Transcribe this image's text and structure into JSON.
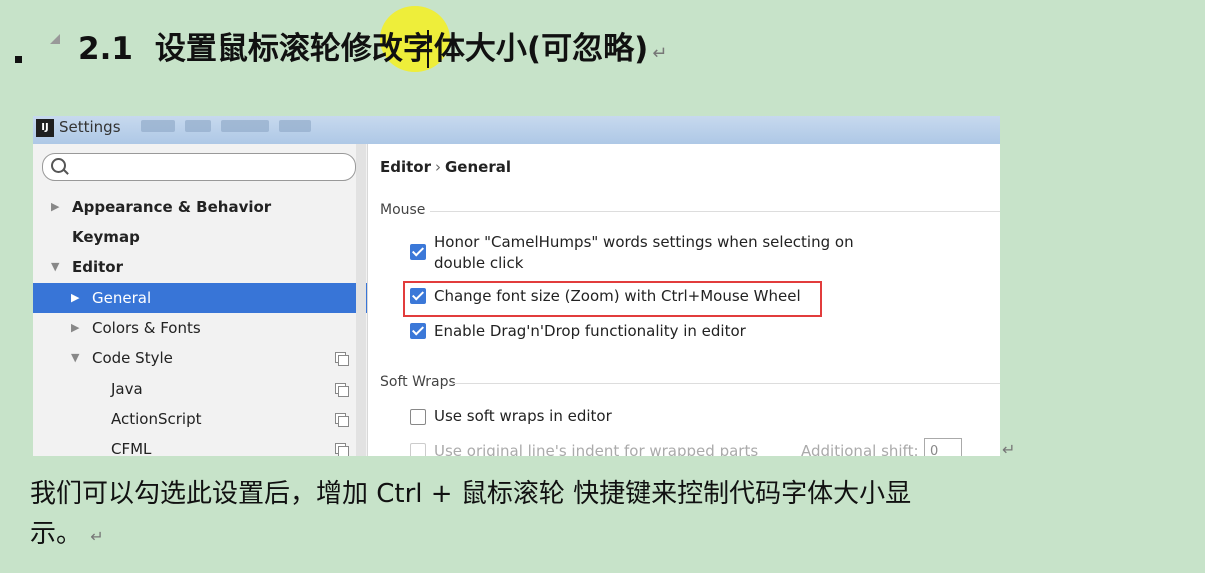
{
  "heading": {
    "number": "2.1",
    "title": "设置鼠标滚轮修改字体大小(可忽略)",
    "mark": "↵"
  },
  "window": {
    "logo": "IJ",
    "title": "Settings",
    "search_placeholder": ""
  },
  "sidebar": {
    "items": [
      {
        "label": "Appearance & Behavior",
        "arrow": "▶"
      },
      {
        "label": "Keymap",
        "arrow": ""
      },
      {
        "label": "Editor",
        "arrow": "▼"
      },
      {
        "label": "General",
        "arrow": "▶"
      },
      {
        "label": "Colors & Fonts",
        "arrow": "▶"
      },
      {
        "label": "Code Style",
        "arrow": "▼"
      },
      {
        "label": "Java",
        "arrow": ""
      },
      {
        "label": "ActionScript",
        "arrow": ""
      },
      {
        "label": "CFML",
        "arrow": ""
      }
    ]
  },
  "panel": {
    "breadcrumb_parent": "Editor",
    "breadcrumb_sep": "›",
    "breadcrumb_current": "General",
    "section_mouse": "Mouse",
    "opt_camel_line1": "Honor \"CamelHumps\" words settings when selecting on",
    "opt_camel_line2": "double click",
    "opt_zoom": "Change font size (Zoom) with Ctrl+Mouse Wheel",
    "opt_dnd": "Enable Drag'n'Drop functionality in editor",
    "section_wraps": "Soft Wraps",
    "opt_soft_wraps": "Use soft wraps in editor",
    "opt_indent": "Use original line's indent for wrapped parts",
    "additional_shift_label": "Additional shift:",
    "additional_shift_value": "0"
  },
  "paragraph": {
    "line1": "我们可以勾选此设置后，增加 Ctrl + 鼠标滚轮 快捷键来控制代码字体大小显",
    "line2": "示。",
    "mark": "↵"
  },
  "colors": {
    "page_bg": "#c7e3c9",
    "selection": "#3875d7",
    "checkbox": "#3b78d8",
    "highlight_box": "#e23c3c",
    "highlighter": "#f2ee2a"
  }
}
